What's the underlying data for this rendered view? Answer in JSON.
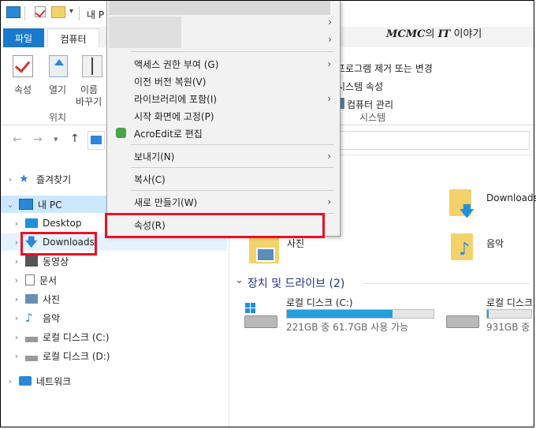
{
  "ribbon": {
    "tab_file": "파일",
    "tab_computer": "컴퓨터",
    "btn_properties": "속성",
    "btn_open": "열기",
    "btn_rename_1": "이름",
    "btn_rename_2": "바꾸기",
    "group_location": "위치",
    "system_items": [
      "프로그램 제거 또는 변경",
      "시스템 속성",
      "컴퓨터 관리"
    ],
    "group_system": "시스템"
  },
  "qat": {
    "title_fragment": "내 P"
  },
  "watermark": {
    "brand": "MCMC",
    "mid": "의",
    "it": "IT",
    "tail": "이야기"
  },
  "tree": {
    "favorites": "즐겨찾기",
    "this_pc": "내 PC",
    "items": [
      "Desktop",
      "Downloads",
      "동영상",
      "문서",
      "사진",
      "음악",
      "로컬 디스크 (C:)",
      "로컬 디스크 (D:)"
    ],
    "network": "네트워크"
  },
  "context_menu": {
    "items": [
      "액세스 권한 부여 (G)",
      "이전 버전 복원(V)",
      "라이브러리에 포함(I)",
      "시작 화면에 고정(P)",
      "AcroEdit로 편집",
      "보내기(N)",
      "복사(C)",
      "새로 만들기(W)",
      "속성(R)"
    ]
  },
  "content": {
    "folders": [
      "Downloads",
      "사진",
      "음악"
    ],
    "section_title": "장치 및 드라이브 (2)",
    "drive_c_name": "로컬 디스크 (C:)",
    "drive_c_space": "221GB 중 61.7GB 사용 가능",
    "drive_c_used_fraction": 0.72,
    "drive_d_name": "로컬 디스크",
    "drive_d_space": "931GB 중",
    "drive_d_used_fraction": 0.04
  },
  "colors": {
    "accent": "#1979ca",
    "highlight": "#e81123",
    "selection": "#cce8ff"
  }
}
